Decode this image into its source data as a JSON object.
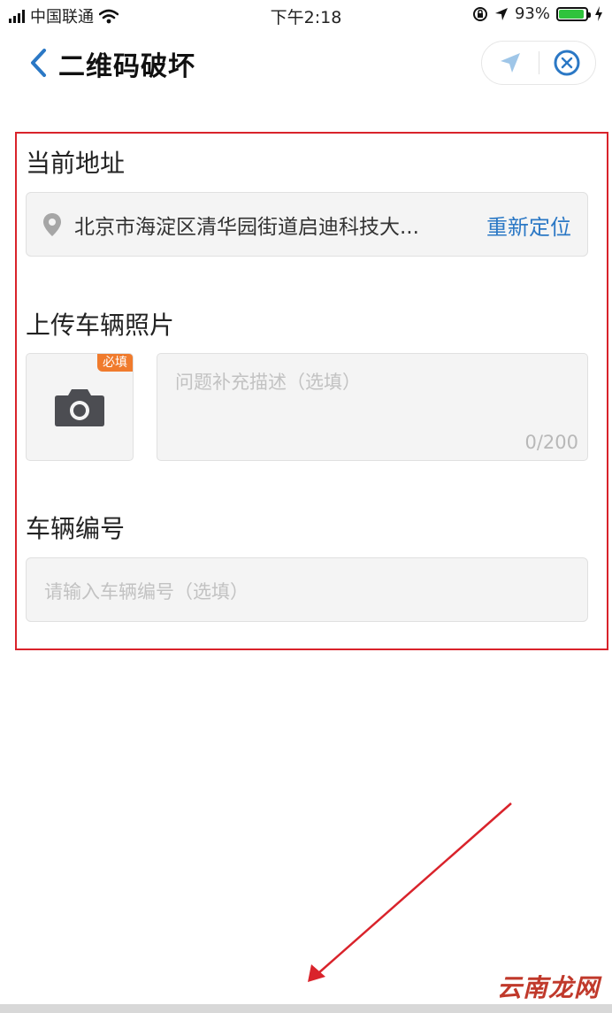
{
  "status_bar": {
    "carrier": "中国联通",
    "time": "下午2:18",
    "battery_percent": "93%",
    "battery_level": 0.93,
    "icons": [
      "signal-icon",
      "wifi-icon",
      "orientation-lock-icon",
      "location-arrow-icon",
      "battery-icon",
      "charging-icon"
    ]
  },
  "nav": {
    "title": "二维码破坏",
    "icons": [
      "back-chevron-icon",
      "location-send-icon",
      "close-circle-icon"
    ]
  },
  "form": {
    "address_label": "当前地址",
    "address_value": "北京市海淀区清华园街道启迪科技大...",
    "relocate_label": "重新定位",
    "photo_label": "上传车辆照片",
    "required_tag": "必填",
    "description_placeholder": "问题补充描述（选填）",
    "description_counter": "0/200",
    "vehicle_number_label": "车辆编号",
    "vehicle_number_placeholder": "请输入车辆编号（选填）"
  },
  "colors": {
    "accent_blue": "#2b78c5",
    "required_orange": "#f07b2d",
    "annotation_red": "#d9232b"
  },
  "watermark": "云南龙网"
}
